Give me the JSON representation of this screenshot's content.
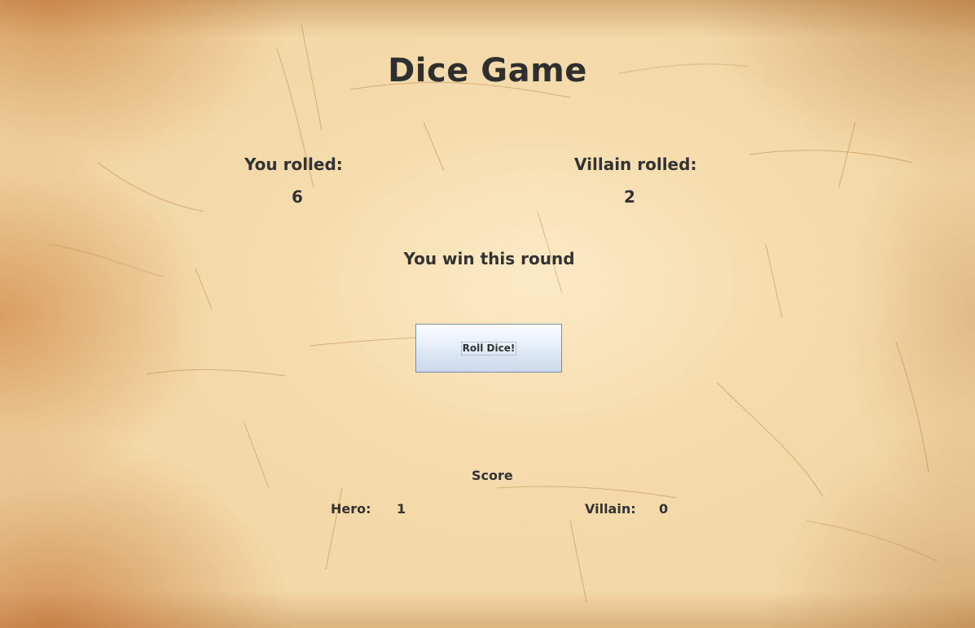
{
  "app": {
    "title": "Dice Game"
  },
  "rolls": {
    "player_label": "You rolled:",
    "player_value": "6",
    "villain_label": "Villain rolled:",
    "villain_value": "2"
  },
  "result": {
    "message": "You win this round"
  },
  "controls": {
    "roll_button_label": "Roll Dice!"
  },
  "score": {
    "title": "Score",
    "hero_label": "Hero:",
    "hero_value": "1",
    "villain_label": "Villain:",
    "villain_value": "0"
  },
  "colors": {
    "parchment": "#f3d9a8",
    "text": "#2e2e2e",
    "button_top": "#fbfdff",
    "button_bottom": "#c9d8ea",
    "button_border": "#7a8ea8"
  }
}
